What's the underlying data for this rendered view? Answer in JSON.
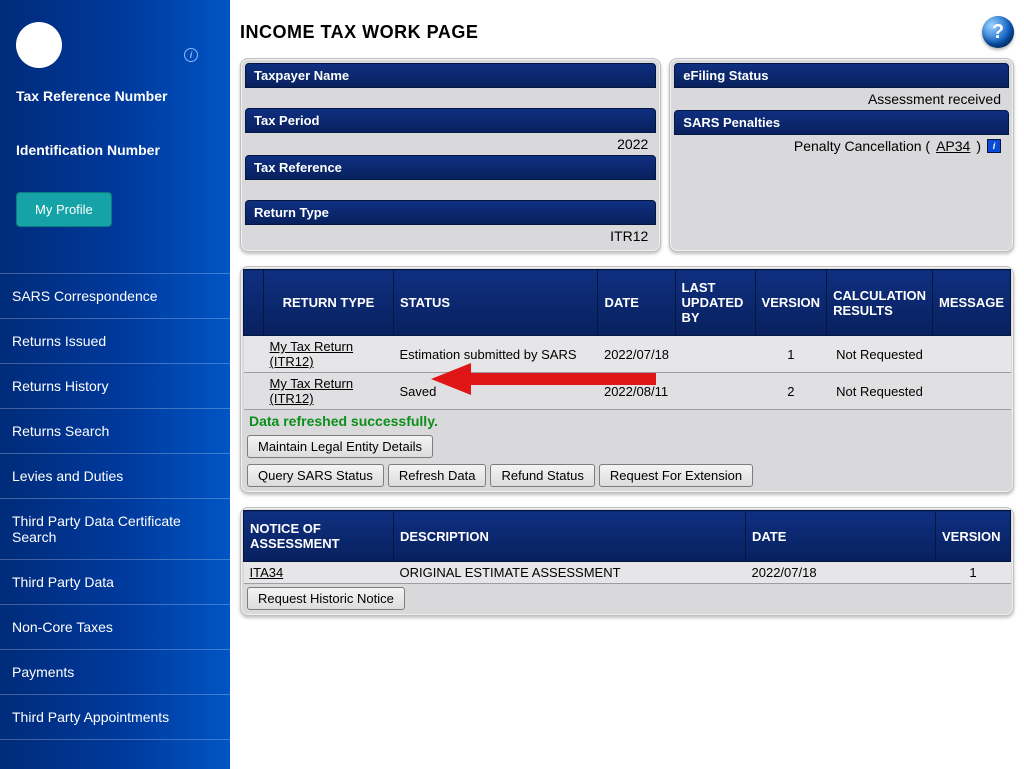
{
  "sidebar": {
    "tax_ref_label": "Tax Reference Number",
    "id_num_label": "Identification Number",
    "profile_btn": "My Profile",
    "nav": [
      "SARS Correspondence",
      "Returns Issued",
      "Returns History",
      "Returns Search",
      "Levies and Duties",
      "Third Party Data Certificate Search",
      "Third Party Data",
      "Non-Core Taxes",
      "Payments",
      "Third Party Appointments"
    ]
  },
  "main": {
    "title": "INCOME TAX WORK PAGE",
    "taxpayer": {
      "name_label": "Taxpayer Name",
      "name_value": "",
      "period_label": "Tax Period",
      "period_value": "2022",
      "ref_label": "Tax Reference",
      "ref_value": "",
      "return_type_label": "Return Type",
      "return_type_value": "ITR12"
    },
    "efiling": {
      "status_label": "eFiling Status",
      "status_value": "Assessment received",
      "penalty_label": "SARS Penalties",
      "penalty_text": "Penalty Cancellation ( ",
      "penalty_link": "AP34",
      "penalty_after": " )"
    },
    "returns_table": {
      "headers": {
        "blank": "",
        "return_type": "RETURN TYPE",
        "status": "STATUS",
        "date": "DATE",
        "last_updated_by": "LAST UPDATED BY",
        "version": "VERSION",
        "calc_results": "CALCULATION RESULTS",
        "message": "MESSAGE"
      },
      "rows": [
        {
          "link": "My Tax Return (ITR12)",
          "status": "Estimation submitted by SARS",
          "date": "2022/07/18",
          "lub": "",
          "version": "1",
          "calc": "Not Requested",
          "msg": ""
        },
        {
          "link": "My Tax Return (ITR12)",
          "status": "Saved",
          "date": "2022/08/11",
          "lub": "",
          "version": "2",
          "calc": "Not Requested",
          "msg": ""
        }
      ],
      "status_msg": "Data refreshed successfully.",
      "btn_maintain": "Maintain Legal Entity Details",
      "btn_query": "Query SARS Status",
      "btn_refresh": "Refresh Data",
      "btn_refund": "Refund Status",
      "btn_extension": "Request For Extension"
    },
    "noa_table": {
      "headers": {
        "noa": "NOTICE OF ASSESSMENT",
        "desc": "DESCRIPTION",
        "date": "DATE",
        "version": "VERSION"
      },
      "rows": [
        {
          "link": "ITA34",
          "desc": "ORIGINAL ESTIMATE ASSESSMENT",
          "date": "2022/07/18",
          "version": "1"
        }
      ],
      "btn_historic": "Request Historic Notice"
    }
  }
}
